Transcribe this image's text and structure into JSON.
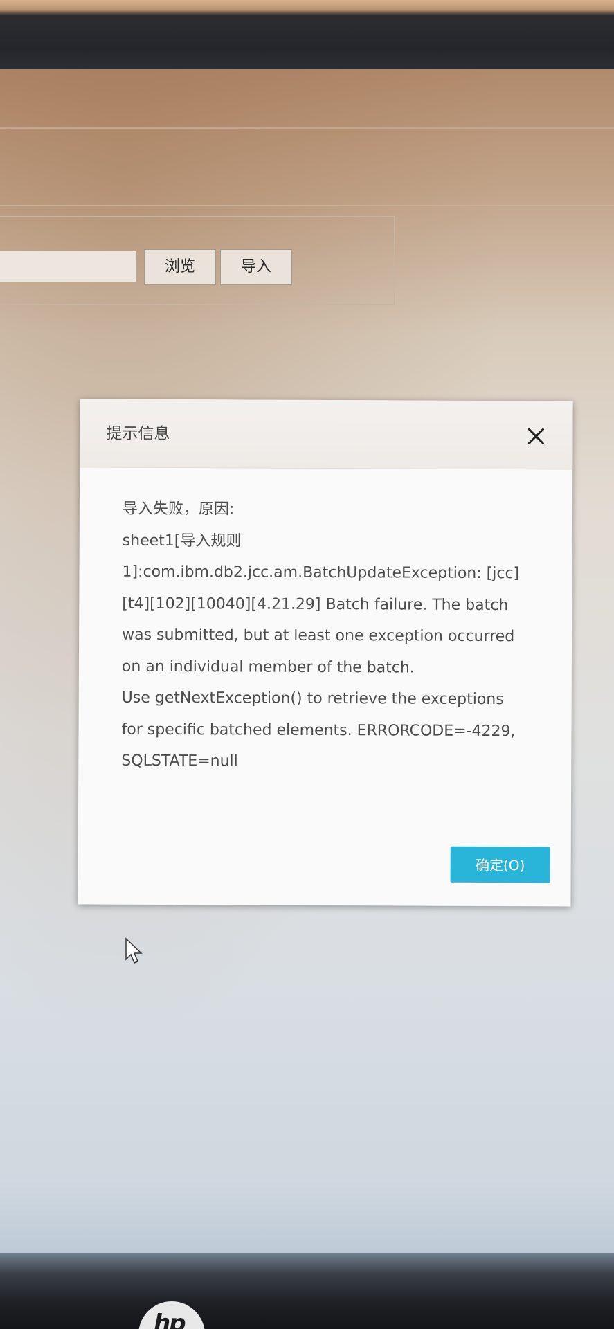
{
  "toolbar": {
    "browse_label": "浏览",
    "import_label": "导入"
  },
  "dialog": {
    "title": "提示信息",
    "close_icon": "close-icon",
    "message_lines": [
      "导入失败，原因:",
      "sheet1[导入规则",
      "1]:com.ibm.db2.jcc.am.BatchUpdateException: [jcc]",
      "[t4][102][10040][4.21.29] Batch failure. The batch",
      "was submitted, but at least one exception occurred",
      "on an individual member of the batch.",
      "Use getNextException() to retrieve the exceptions",
      "for specific batched elements. ERRORCODE=-4229,",
      "SQLSTATE=null"
    ],
    "ok_label": "确定(O)",
    "ok_color": "#29b5d9"
  },
  "device": {
    "brand_logo": "hp"
  }
}
